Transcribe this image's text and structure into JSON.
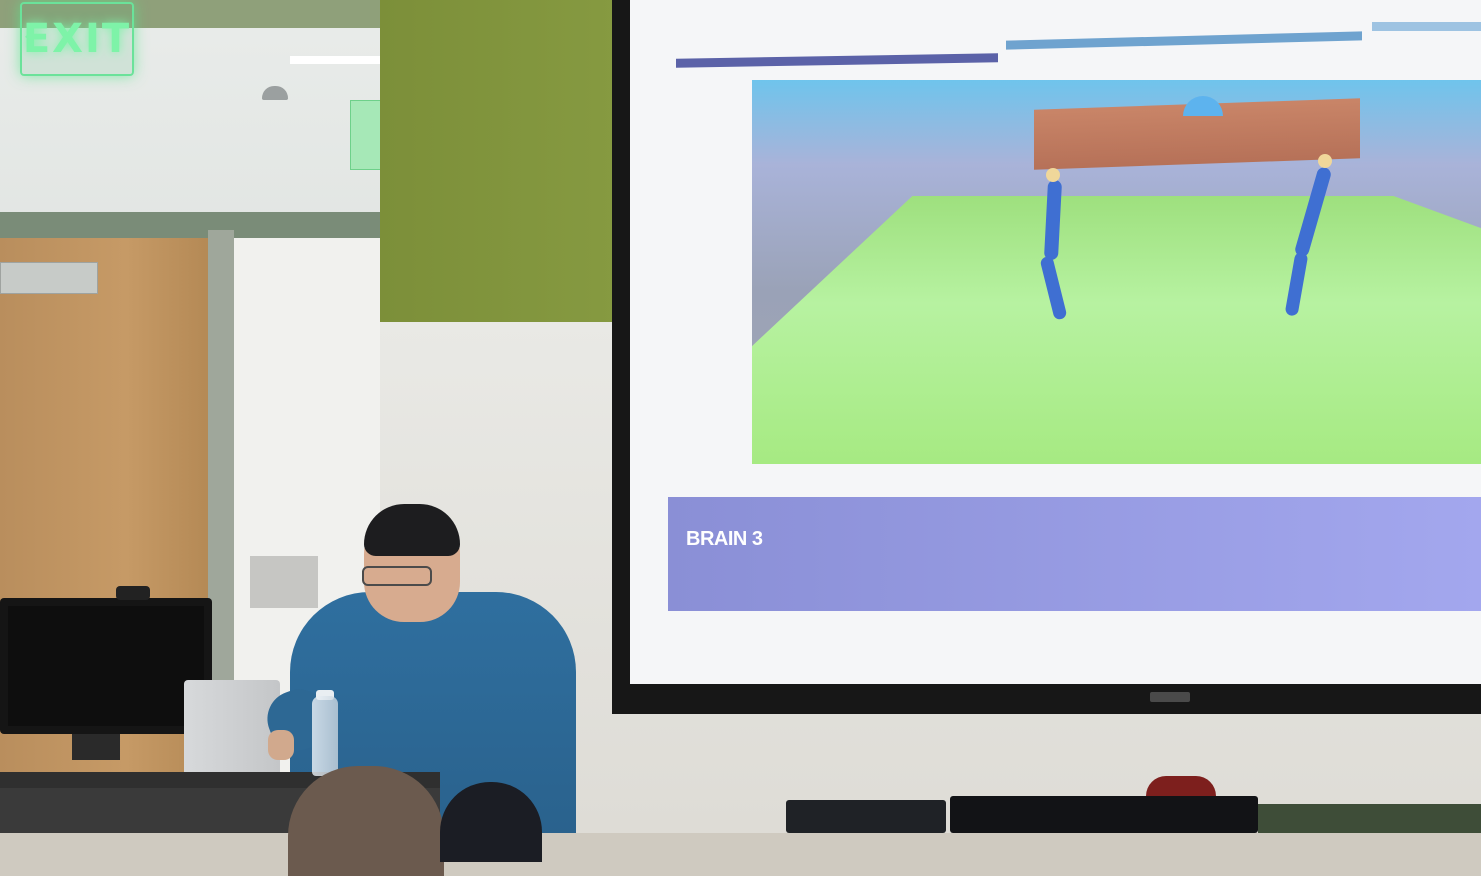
{
  "signage": {
    "exit_label": "EXIT"
  },
  "presentation": {
    "caption": "BRAIN 3",
    "colors": {
      "caption_bar": "#979be6",
      "progress_bar_active": "#5b62a8",
      "progress_bar_2": "#6fa3cf",
      "progress_bar_3": "#9ec3e2",
      "sky": "#6fc4ec",
      "ground": "#a6ea82",
      "robot_body": "#c27b61",
      "robot_legs": "#3f6fd2"
    }
  },
  "scene": {
    "person_shirt_color": "#2f6f9f",
    "wall_accent_color": "#869a41"
  }
}
